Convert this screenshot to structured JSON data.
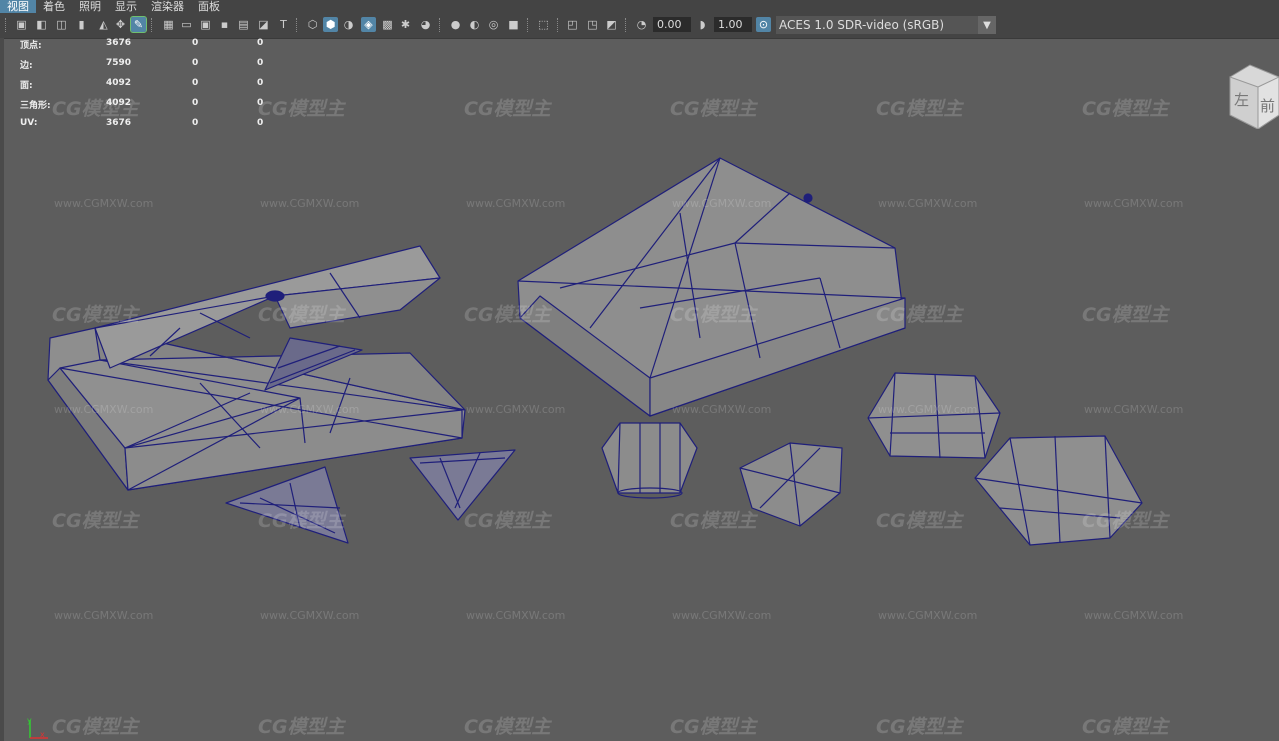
{
  "menu": [
    "视图",
    "着色",
    "照明",
    "显示",
    "渲染器",
    "面板"
  ],
  "toolbar": {
    "exposure_value": "0.00",
    "gamma_value": "1.00",
    "color_space": "ACES 1.0 SDR-video (sRGB)"
  },
  "hud": {
    "rows": [
      {
        "label": "顶点:",
        "a": "3676",
        "b": "0",
        "c": "0"
      },
      {
        "label": "边:",
        "a": "7590",
        "b": "0",
        "c": "0"
      },
      {
        "label": "面:",
        "a": "4092",
        "b": "0",
        "c": "0"
      },
      {
        "label": "三角形:",
        "a": "4092",
        "b": "0",
        "c": "0"
      },
      {
        "label": "UV:",
        "a": "3676",
        "b": "0",
        "c": "0"
      }
    ]
  },
  "viewcube": {
    "left_label": "左",
    "front_label": "前"
  },
  "axis": {
    "y_label": "y",
    "x_label": "x"
  },
  "watermark": {
    "logo": "CG模型主",
    "url": "www.CGMXW.com"
  },
  "colors": {
    "wire": "#1f1f7a",
    "mesh_fill": "#8a8a8a",
    "viewport_bg": "#5d5d5d",
    "accent": "#5285a6"
  }
}
